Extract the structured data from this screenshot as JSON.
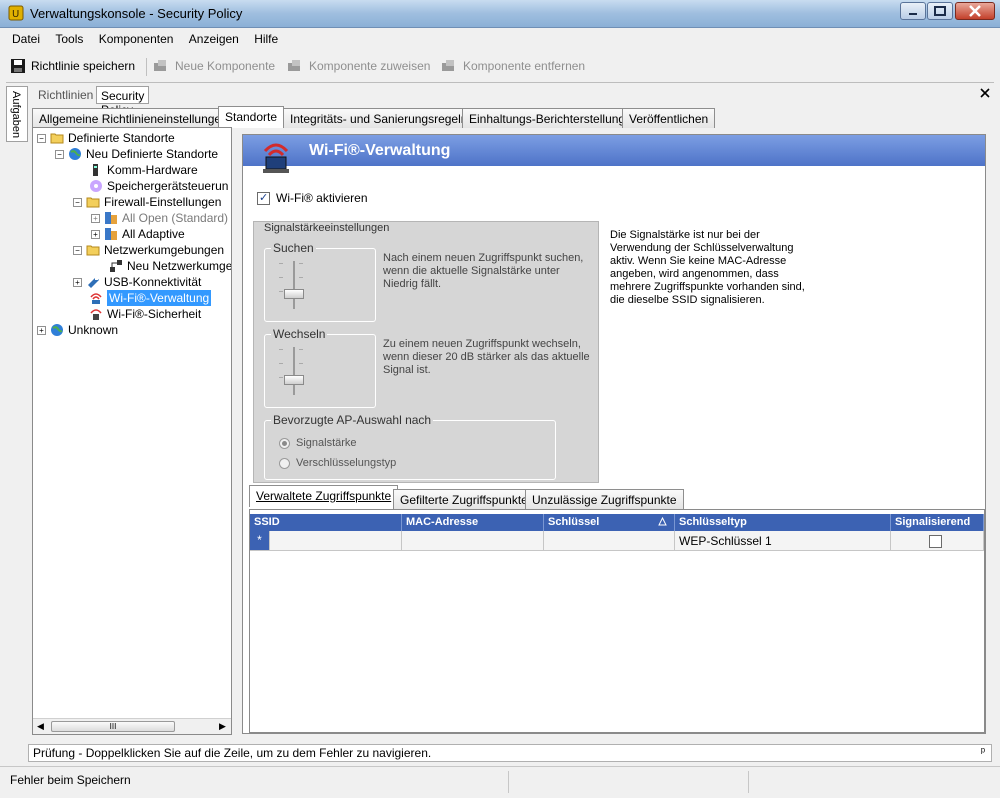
{
  "window": {
    "title": "Verwaltungskonsole - Security Policy"
  },
  "menu": [
    "Datei",
    "Tools",
    "Komponenten",
    "Anzeigen",
    "Hilfe"
  ],
  "toolbar": {
    "save": "Richtlinie speichern",
    "new_component": "Neue Komponente",
    "assign_component": "Komponente zuweisen",
    "remove_component": "Komponente entfernen"
  },
  "side_tab": "Aufgaben",
  "doc_tabs": [
    "Richtlinien",
    "Security Policy"
  ],
  "policy_tabs": [
    "Allgemeine Richtlinieneinstellungen",
    "Standorte",
    "Integritäts- und Sanierungsregeln",
    "Einhaltungs-Berichterstellung",
    "Veröffentlichen"
  ],
  "tree": {
    "root": "Definierte Standorte",
    "location": "Neu Definierte Standorte",
    "comm_hw": "Komm-Hardware",
    "storage": "Speichergerätsteuerun",
    "firewall": "Firewall-Einstellungen",
    "all_open": "All Open (Standard)",
    "all_adaptive": "All Adaptive",
    "netenv": "Netzwerkumgebungen",
    "new_netenv": "Neu Netzwerkumge",
    "usb": "USB-Konnektivität",
    "wifi_mgmt": "Wi-Fi®-Verwaltung",
    "wifi_sec": "Wi-Fi®-Sicherheit",
    "unknown": "Unknown",
    "scroll_grip": "III"
  },
  "panel": {
    "title": "Wi-Fi®-Verwaltung",
    "enable_label": "Wi-Fi® aktivieren",
    "signal_group": "Signalstärkeeinstellungen",
    "search_group": "Suchen",
    "search_desc": "Nach einem neuen Zugriffspunkt suchen, wenn die aktuelle Signalstärke unter Niedrig fällt.",
    "switch_group": "Wechseln",
    "switch_desc": "Zu einem neuen Zugriffspunkt wechseln, wenn dieser 20 dB stärker als das aktuelle Signal ist.",
    "ap_group": "Bevorzugte AP-Auswahl nach",
    "radio_signal": "Signalstärke",
    "radio_enc": "Verschlüsselungstyp",
    "info": "Die Signalstärke ist nur bei der Verwendung der Schlüsselverwaltung aktiv. Wenn Sie keine MAC-Adresse angeben, wird angenommen, dass mehrere Zugriffspunkte vorhanden sind, die dieselbe SSID signalisieren."
  },
  "ap_tabs": [
    "Verwaltete Zugriffspunkte",
    "Gefilterte Zugriffspunkte",
    "Unzulässige Zugriffspunkte"
  ],
  "grid": {
    "columns": [
      "SSID",
      "MAC-Adresse",
      "Schlüssel",
      "Schlüsseltyp",
      "Signalisierend"
    ],
    "new_row_marker": "*",
    "row_keytype": "WEP-Schlüssel 1"
  },
  "error_bar": "Prüfung - Doppelklicken Sie auf die Zeile, um zu dem Fehler zu navigieren.",
  "pin_glyph": "ᵖ",
  "status": "Fehler beim Speichern"
}
